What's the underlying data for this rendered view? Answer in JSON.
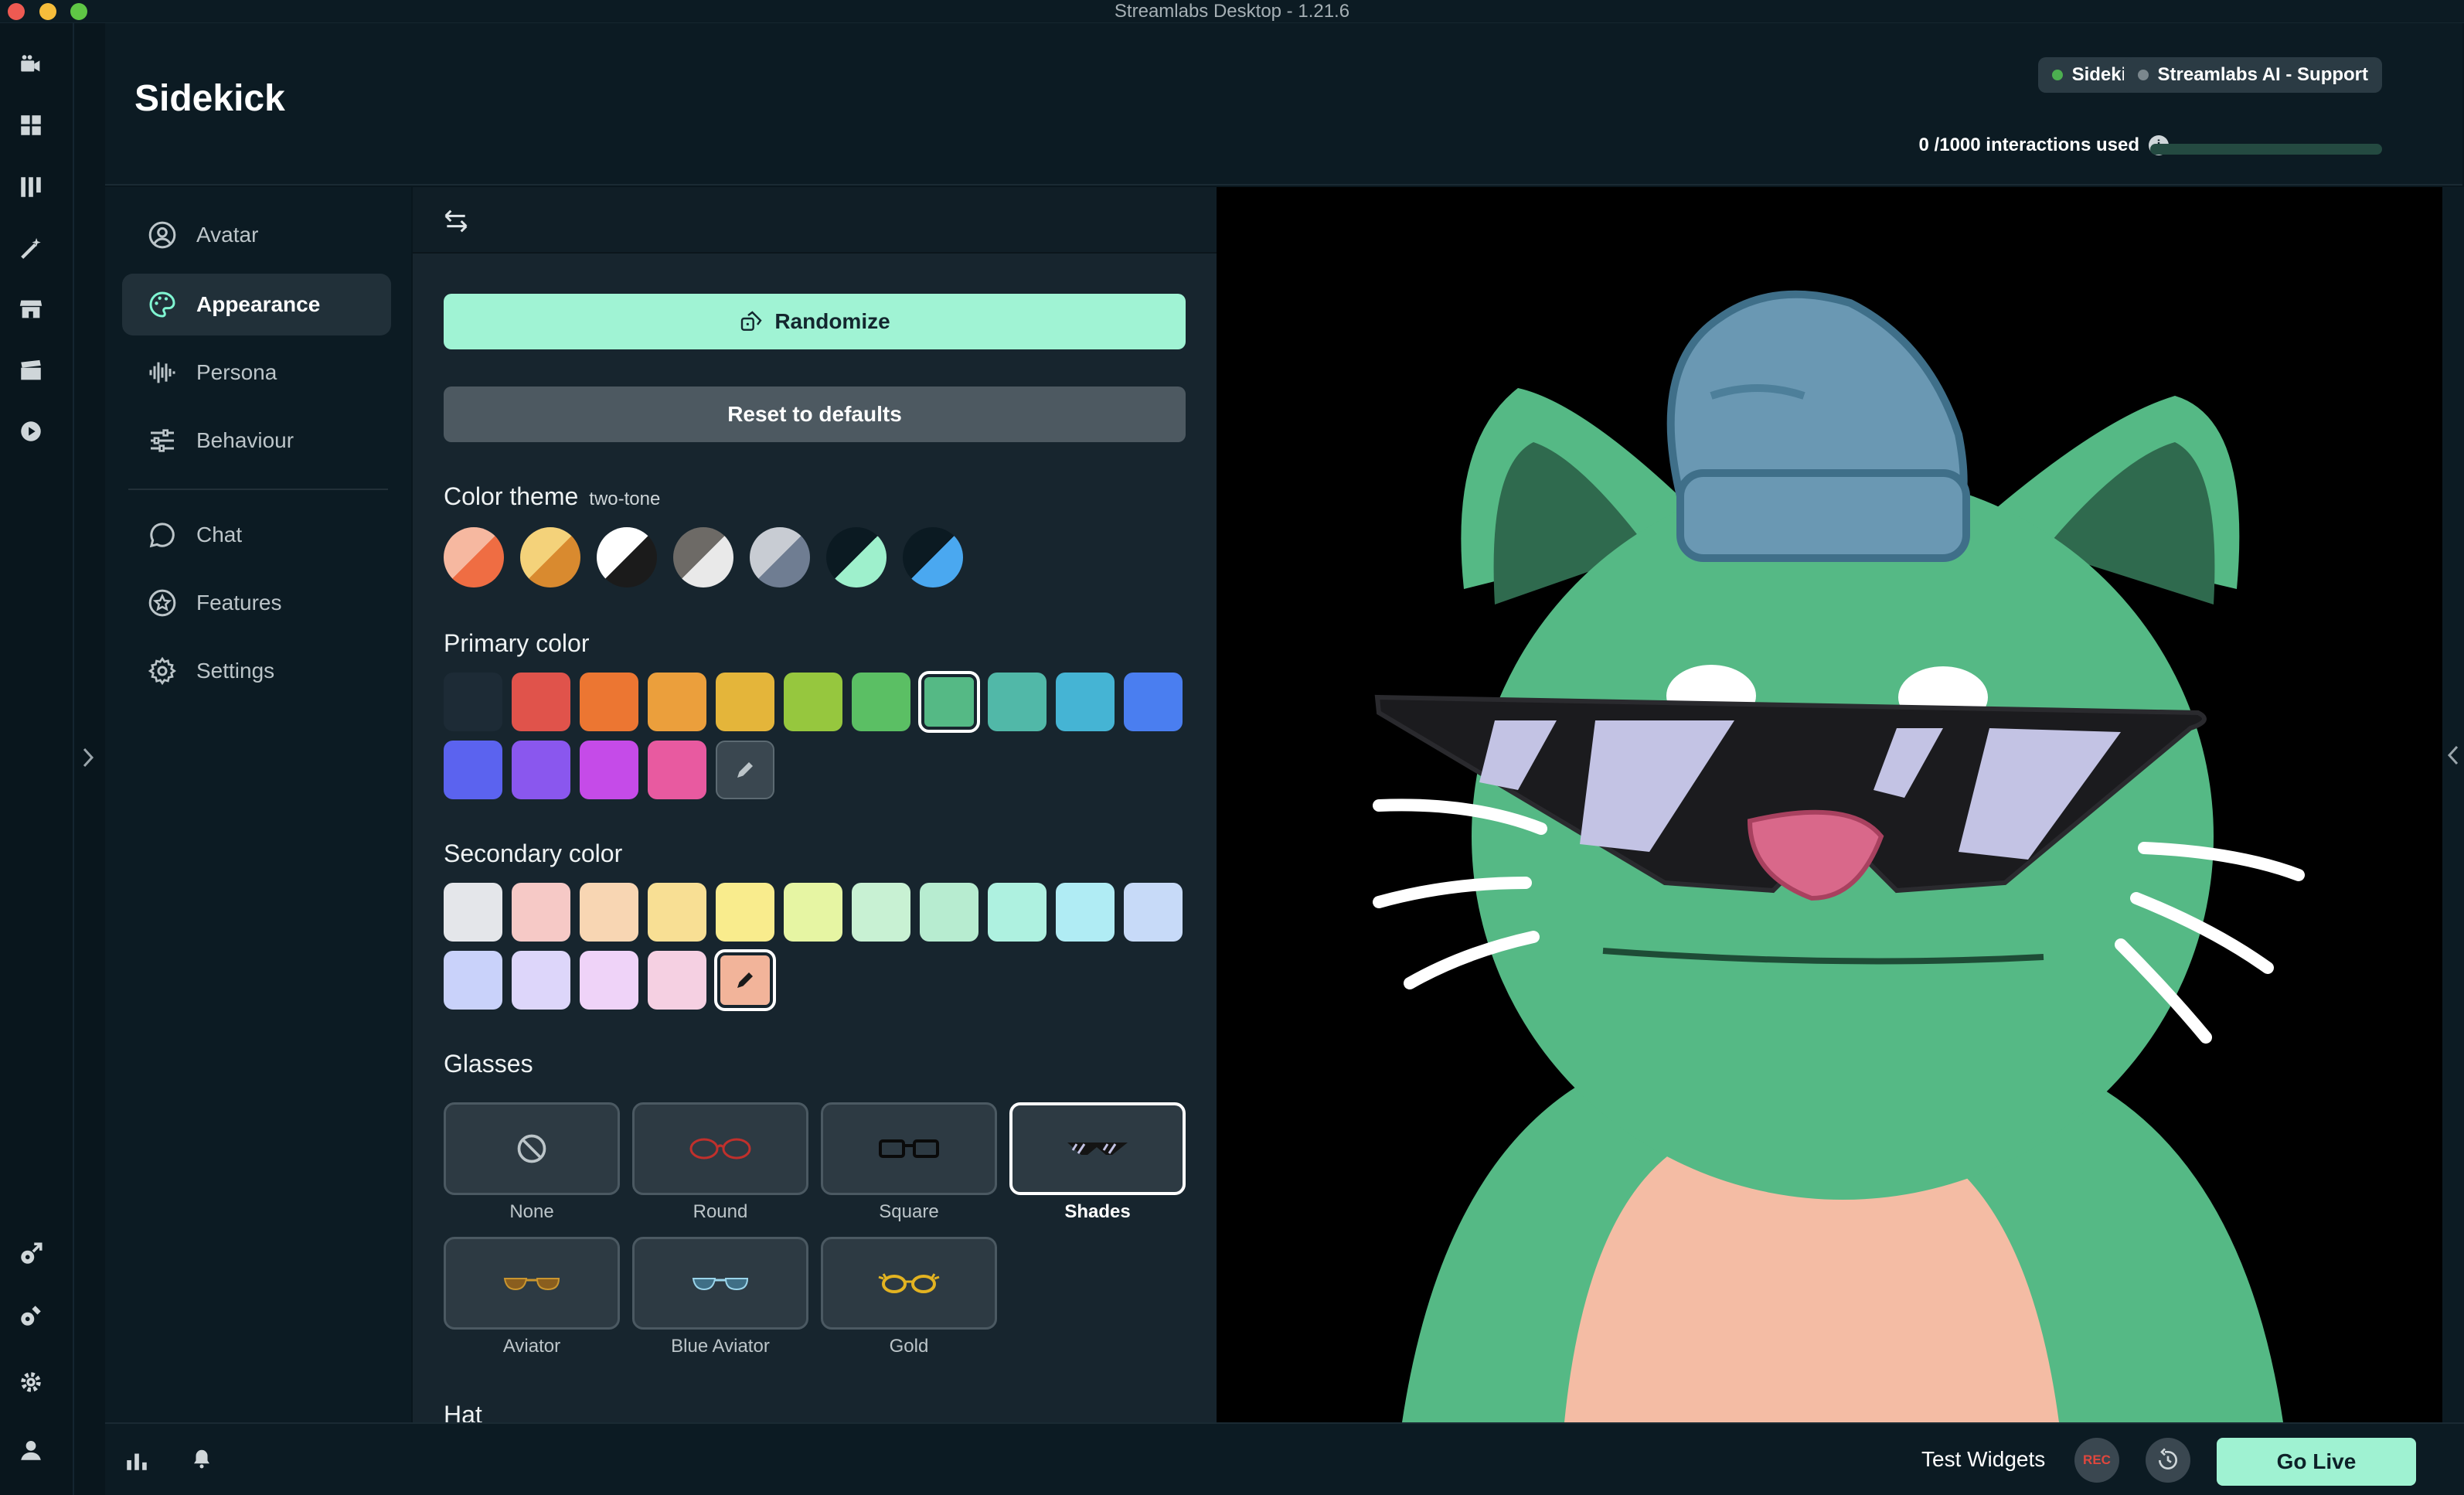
{
  "window": {
    "title": "Streamlabs Desktop - 1.21.6"
  },
  "header": {
    "title": "Sidekick",
    "badges": [
      {
        "label": "Sidekick",
        "status_color": "#4caf50"
      },
      {
        "label": "Streamlabs AI - Support",
        "status_color": "#7b878d"
      }
    ],
    "usage_count": "0",
    "usage_text": " /1000 interactions used",
    "usage_fraction": 0.0
  },
  "nav": {
    "items": [
      {
        "label": "Avatar",
        "icon": "user-circle-icon"
      },
      {
        "label": "Appearance",
        "icon": "palette-icon",
        "active": true
      },
      {
        "label": "Persona",
        "icon": "waveform-icon"
      },
      {
        "label": "Behaviour",
        "icon": "sliders-icon"
      },
      {
        "label": "Chat",
        "icon": "chat-bubble-icon"
      },
      {
        "label": "Features",
        "icon": "star-badge-icon"
      },
      {
        "label": "Settings",
        "icon": "gear-icon"
      }
    ]
  },
  "panel": {
    "randomize_label": "Randomize",
    "reset_label": "Reset to defaults",
    "color_theme": {
      "title": "Color theme",
      "value": "two-tone",
      "swatches": [
        [
          "#f6b8a0",
          "#ef6d43"
        ],
        [
          "#f4d27a",
          "#d98a2f"
        ],
        [
          "#ffffff",
          "#1b1b1b"
        ],
        [
          "#6d6a66",
          "#e9e9e9"
        ],
        [
          "#c8ccd3",
          "#6f7d92"
        ],
        [
          "#0b1a22",
          "#9ef0cc"
        ],
        [
          "#0b1a22",
          "#4aa8f0"
        ]
      ]
    },
    "primary_color": {
      "title": "Primary color",
      "swatches": [
        "#1d2b36",
        "#e0534b",
        "#ec7632",
        "#eb9f3c",
        "#e4b53a",
        "#96c73e",
        "#5bbf64",
        "#55b985",
        "#51b8a8",
        "#45b4d4",
        "#4a7ef0",
        "#5b63ef",
        "#8a57ee",
        "#c54be8",
        "#e85aa0"
      ],
      "selected_index": 7
    },
    "secondary_color": {
      "title": "Secondary color",
      "swatches": [
        "#e4e6ea",
        "#f6c9c6",
        "#f8d6b3",
        "#f8df94",
        "#f9ec8d",
        "#e6f5a3",
        "#c8f1d3",
        "#b7ecd0",
        "#aef1e0",
        "#b0ecf4",
        "#c7daf8",
        "#c9d2fa",
        "#ddd6fa",
        "#efd3f8",
        "#f5d0e2"
      ],
      "custom_color": "#f2b49a",
      "custom_selected": true
    },
    "glasses": {
      "title": "Glasses",
      "options": [
        {
          "label": "None",
          "icon": "none-icon"
        },
        {
          "label": "Round",
          "icon": "round-glasses-icon"
        },
        {
          "label": "Square",
          "icon": "square-glasses-icon"
        },
        {
          "label": "Shades",
          "icon": "shades-icon",
          "selected": true
        },
        {
          "label": "Aviator",
          "icon": "aviator-glasses-icon"
        },
        {
          "label": "Blue Aviator",
          "icon": "blue-aviator-glasses-icon"
        },
        {
          "label": "Gold",
          "icon": "gold-glasses-icon"
        }
      ]
    },
    "hat_title": "Hat"
  },
  "preview": {
    "avatar": "green cat with blue beanie and shades",
    "colors": {
      "body": "#55b985",
      "belly": "#f4bca4",
      "hat": "#6a98b3",
      "nose": "#d9688a",
      "lens": "#c3c3e4"
    }
  },
  "footer": {
    "test_widgets_label": "Test Widgets",
    "rec_label": "REC",
    "go_live_label": "Go Live"
  }
}
